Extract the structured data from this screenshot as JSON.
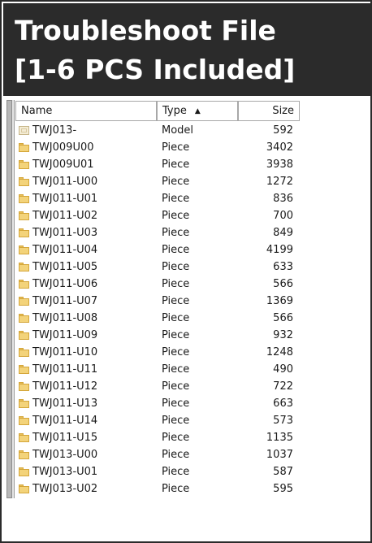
{
  "banner": {
    "line1": "Troubleshoot File",
    "line2": "[1-6 PCS Included]"
  },
  "columns": {
    "name": "Name",
    "type": "Type",
    "size": "Size",
    "sort_indicator": "▲"
  },
  "files": [
    {
      "name": "TWJ013-",
      "type": "Model",
      "size": "592",
      "icon": "model-icon"
    },
    {
      "name": "TWJ009U00",
      "type": "Piece",
      "size": "3402",
      "icon": "folder-icon"
    },
    {
      "name": "TWJ009U01",
      "type": "Piece",
      "size": "3938",
      "icon": "folder-icon"
    },
    {
      "name": "TWJ011-U00",
      "type": "Piece",
      "size": "1272",
      "icon": "folder-icon"
    },
    {
      "name": "TWJ011-U01",
      "type": "Piece",
      "size": "836",
      "icon": "folder-icon"
    },
    {
      "name": "TWJ011-U02",
      "type": "Piece",
      "size": "700",
      "icon": "folder-icon"
    },
    {
      "name": "TWJ011-U03",
      "type": "Piece",
      "size": "849",
      "icon": "folder-icon"
    },
    {
      "name": "TWJ011-U04",
      "type": "Piece",
      "size": "4199",
      "icon": "folder-icon"
    },
    {
      "name": "TWJ011-U05",
      "type": "Piece",
      "size": "633",
      "icon": "folder-icon"
    },
    {
      "name": "TWJ011-U06",
      "type": "Piece",
      "size": "566",
      "icon": "folder-icon"
    },
    {
      "name": "TWJ011-U07",
      "type": "Piece",
      "size": "1369",
      "icon": "folder-icon"
    },
    {
      "name": "TWJ011-U08",
      "type": "Piece",
      "size": "566",
      "icon": "folder-icon"
    },
    {
      "name": "TWJ011-U09",
      "type": "Piece",
      "size": "932",
      "icon": "folder-icon"
    },
    {
      "name": "TWJ011-U10",
      "type": "Piece",
      "size": "1248",
      "icon": "folder-icon"
    },
    {
      "name": "TWJ011-U11",
      "type": "Piece",
      "size": "490",
      "icon": "folder-icon"
    },
    {
      "name": "TWJ011-U12",
      "type": "Piece",
      "size": "722",
      "icon": "folder-icon"
    },
    {
      "name": "TWJ011-U13",
      "type": "Piece",
      "size": "663",
      "icon": "folder-icon"
    },
    {
      "name": "TWJ011-U14",
      "type": "Piece",
      "size": "573",
      "icon": "folder-icon"
    },
    {
      "name": "TWJ011-U15",
      "type": "Piece",
      "size": "1135",
      "icon": "folder-icon"
    },
    {
      "name": "TWJ013-U00",
      "type": "Piece",
      "size": "1037",
      "icon": "folder-icon"
    },
    {
      "name": "TWJ013-U01",
      "type": "Piece",
      "size": "587",
      "icon": "folder-icon"
    },
    {
      "name": "TWJ013-U02",
      "type": "Piece",
      "size": "595",
      "icon": "folder-icon"
    }
  ],
  "colors": {
    "banner_bg": "#2b2b2b",
    "banner_text": "#ffffff",
    "folder": "#f3d37a"
  }
}
